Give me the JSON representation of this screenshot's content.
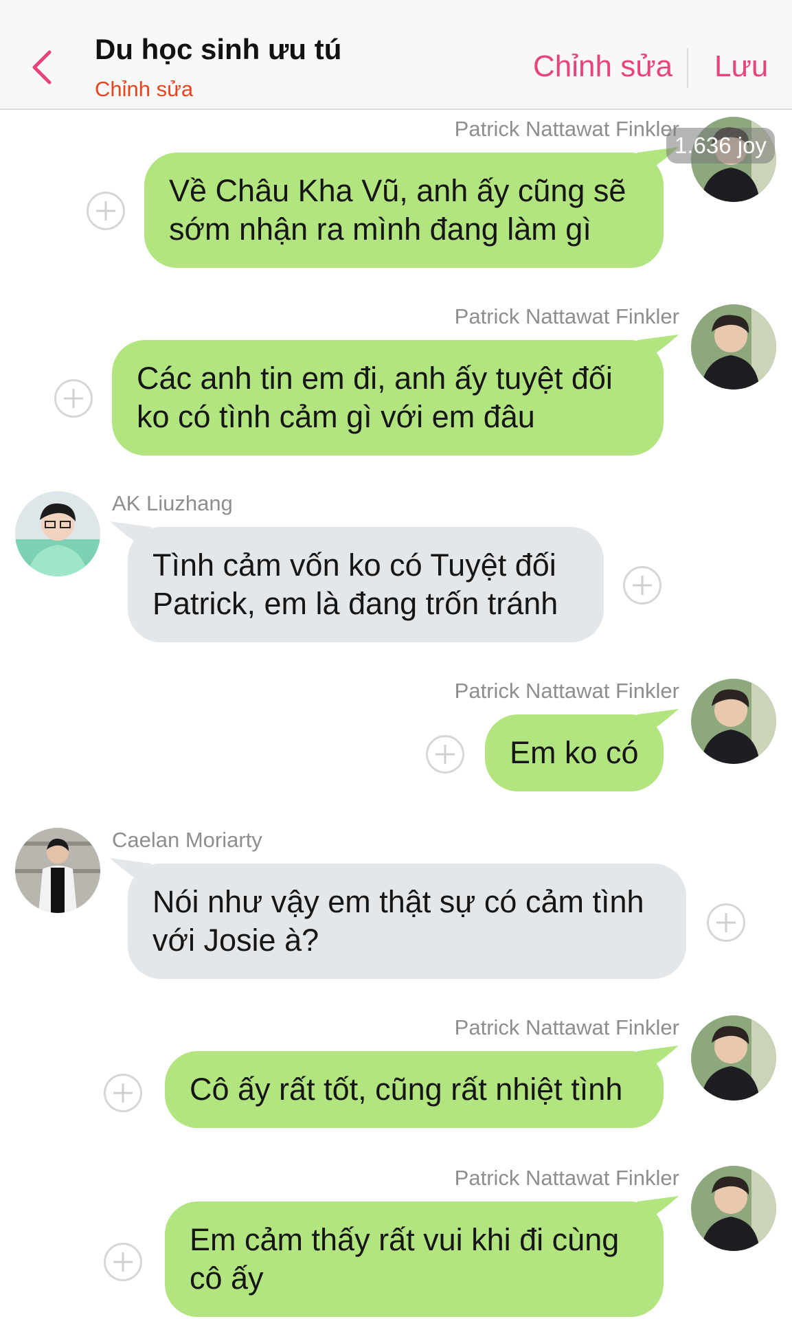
{
  "header": {
    "title": "Du học sinh ưu tú",
    "subtitle": "Chỉnh sửa",
    "edit_label": "Chỉnh sửa",
    "save_label": "Lưu"
  },
  "badge": {
    "joy": "1.636 joy"
  },
  "colors": {
    "accent_pink": "#e5457a",
    "subtitle_red": "#e8451f",
    "outgoing_bubble": "#b2e47f",
    "incoming_bubble": "#e4e7ea"
  },
  "messages": [
    {
      "sender": "Patrick Nattawat Finkler",
      "side": "right",
      "text_lines": [
        "Về Châu Kha Vũ, anh ấy cũng sẽ",
        "sớm nhận ra mình đang làm gì"
      ]
    },
    {
      "sender": "Patrick Nattawat Finkler",
      "side": "right",
      "text_lines": [
        "Các anh tin em đi, anh ấy tuyệt đối",
        "ko có tình cảm gì với em đâu"
      ]
    },
    {
      "sender": "AK Liuzhang",
      "side": "left",
      "text_lines": [
        "Tình cảm vốn ko có Tuyệt đối",
        "Patrick, em là đang trốn tránh"
      ]
    },
    {
      "sender": "Patrick Nattawat Finkler",
      "side": "right",
      "text_lines": [
        "Em ko có"
      ]
    },
    {
      "sender": "Caelan Moriarty",
      "side": "left",
      "text_lines": [
        "Nói như vậy em thật sự có cảm tình",
        "với Josie à?"
      ]
    },
    {
      "sender": "Patrick Nattawat Finkler",
      "side": "right",
      "text_lines": [
        "Cô ấy rất tốt, cũng rất nhiệt tình"
      ]
    },
    {
      "sender": "Patrick Nattawat Finkler",
      "side": "right",
      "text_lines": [
        "Em cảm thấy rất vui khi đi cùng",
        "cô ấy"
      ]
    }
  ]
}
